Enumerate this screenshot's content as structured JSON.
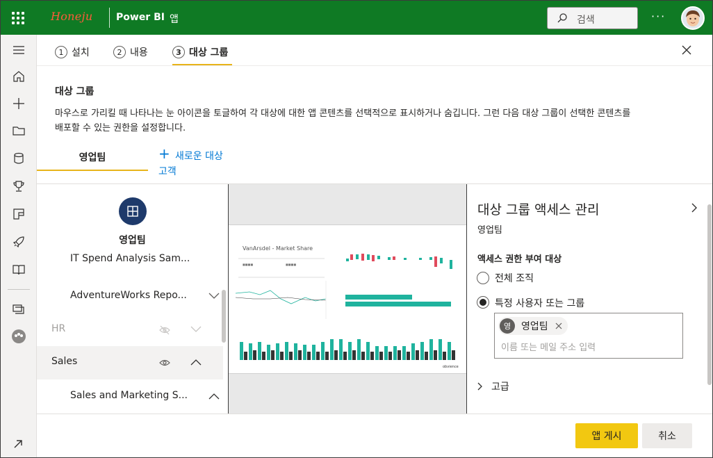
{
  "topbar": {
    "brand": "Honeju",
    "app_name": "Power BI",
    "app_section": "앱",
    "search_placeholder": "검색",
    "more": "···",
    "brand_color": "#0f7a24"
  },
  "left_nav": {
    "icons": [
      "menu-icon",
      "home-icon",
      "create-icon",
      "browse-icon",
      "data-hub-icon",
      "goals-icon",
      "apps-icon",
      "deployment-icon",
      "learn-icon",
      "workspaces-icon",
      "workspace-avatar-icon",
      "expand-icon"
    ]
  },
  "wizard": {
    "steps": [
      {
        "num": "1",
        "label": "설치"
      },
      {
        "num": "2",
        "label": "내용"
      },
      {
        "num": "3",
        "label": "대상 그룹"
      }
    ],
    "active_step": 3
  },
  "audience_section": {
    "title": "대상 그룹",
    "description_line1": "마우스로 가리킬 때 나타나는 눈 아이콘을 토글하여 각 대상에 대한 앱 콘텐츠를 선택적으로 표시하거나 숨깁니다. 그런 다음 대상 그룹이 선택한 콘텐츠를",
    "description_line2": "배포할 수 있는 권한을 설정합니다."
  },
  "audience_tabs": {
    "active_tab": "영업팀",
    "new_audience_line1": "새로운 대상",
    "new_audience_line2": "고객"
  },
  "content_list": {
    "audience_name": "영업팀",
    "items": [
      {
        "label": "IT Spend Analysis Sam...",
        "indent": true
      },
      {
        "label": "AdventureWorks Repo...",
        "indent": true
      },
      {
        "label": "HR",
        "indent": false
      },
      {
        "label": "Sales",
        "indent": false
      },
      {
        "label": "Sales and Marketing S...",
        "indent": true
      }
    ]
  },
  "preview": {
    "report_title": "VanArsdel - Market Share",
    "footer_brand": "obvience"
  },
  "access_panel": {
    "title": "대상 그룹 액세스 관리",
    "subtitle": "영업팀",
    "grant_label": "액세스 권한 부여 대상",
    "option_all": "전체 조직",
    "option_specific": "특정 사용자 또는 그룹",
    "selected_option": "specific",
    "chip_initial": "영",
    "chip_name": "영업팀",
    "people_placeholder": "이름 또는 메일 주소 입력",
    "advanced": "고급"
  },
  "footer": {
    "publish_label": "앱 게시",
    "cancel_label": "취소",
    "publish_color": "#f2c811"
  }
}
